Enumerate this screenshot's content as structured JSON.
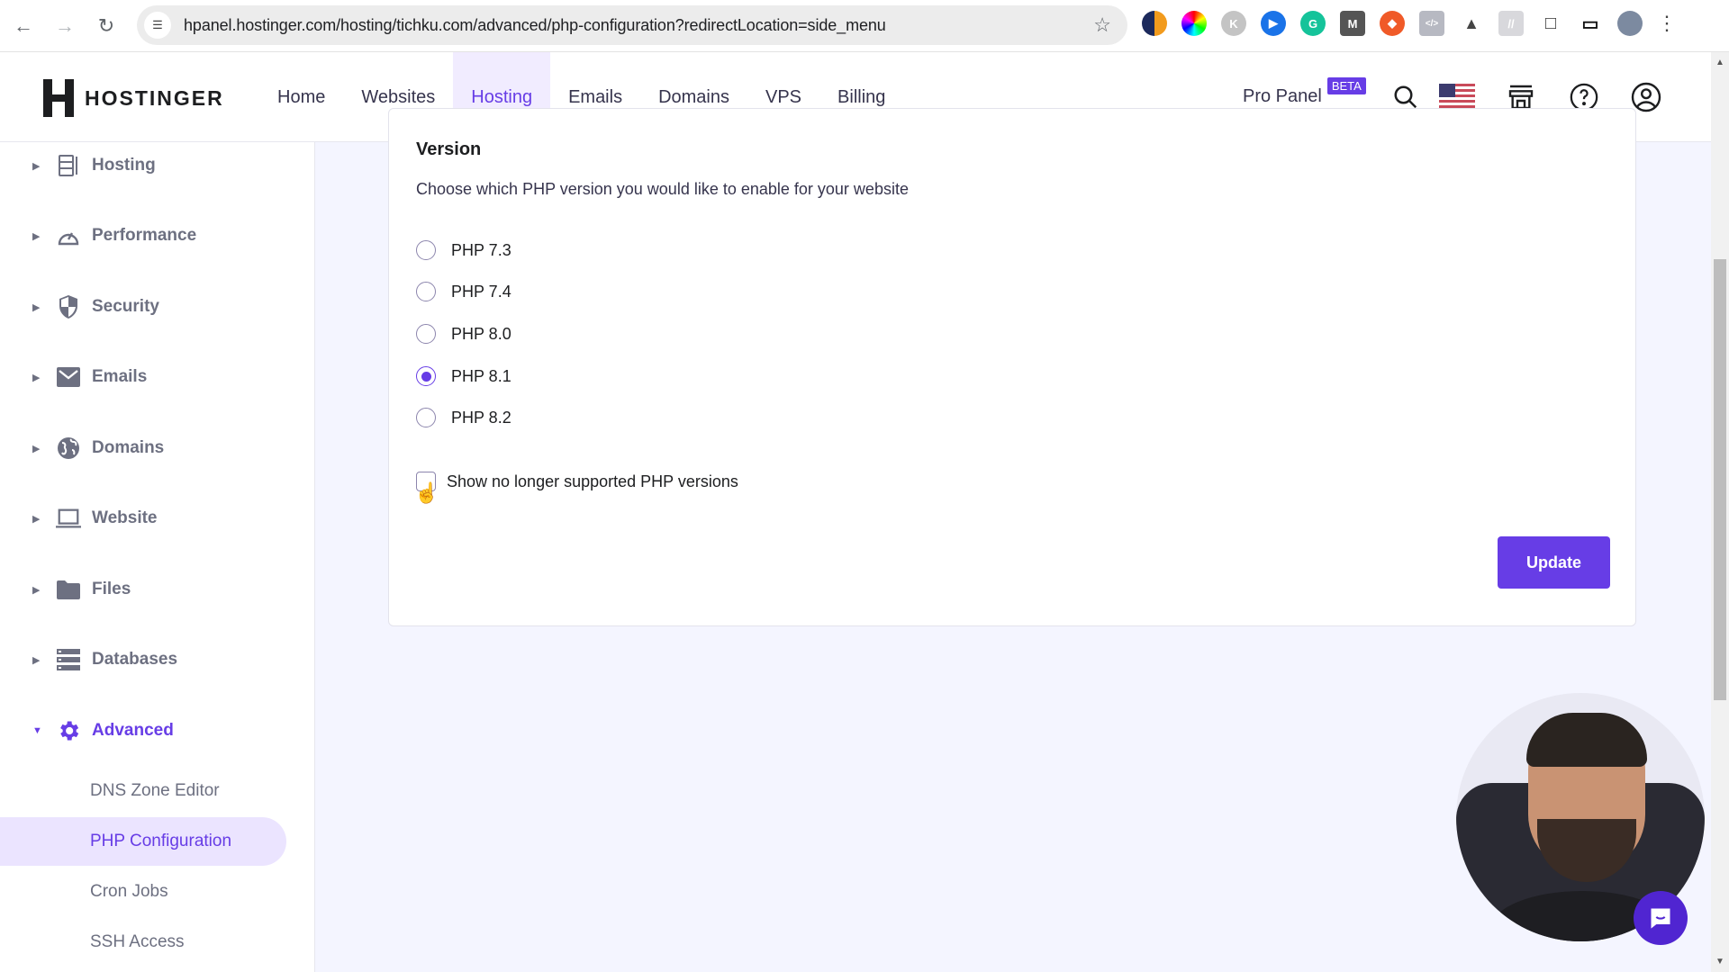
{
  "browser": {
    "url": "hpanel.hostinger.com/hosting/tichku.com/advanced/php-configuration?redirectLocation=side_menu",
    "extensions": [
      "extension-1",
      "color-picker-extension",
      "k-extension",
      "play-extension",
      "grammarly-extension",
      "m-extension",
      "fox-extension",
      "code-extension",
      "a-extension",
      "slash-extension"
    ]
  },
  "header": {
    "brand": "HOSTINGER",
    "nav": [
      {
        "label": "Home",
        "active": false
      },
      {
        "label": "Websites",
        "active": false
      },
      {
        "label": "Hosting",
        "active": true
      },
      {
        "label": "Emails",
        "active": false
      },
      {
        "label": "Domains",
        "active": false
      },
      {
        "label": "VPS",
        "active": false
      },
      {
        "label": "Billing",
        "active": false
      }
    ],
    "pro_panel": "Pro Panel",
    "beta_badge": "BETA"
  },
  "sidebar": {
    "items": [
      {
        "label": "Hosting",
        "icon": "server-icon",
        "expanded": false
      },
      {
        "label": "Performance",
        "icon": "speedometer-icon",
        "expanded": false
      },
      {
        "label": "Security",
        "icon": "shield-icon",
        "expanded": false
      },
      {
        "label": "Emails",
        "icon": "envelope-icon",
        "expanded": false
      },
      {
        "label": "Domains",
        "icon": "globe-icon",
        "expanded": false
      },
      {
        "label": "Website",
        "icon": "laptop-icon",
        "expanded": false
      },
      {
        "label": "Files",
        "icon": "folder-icon",
        "expanded": false
      },
      {
        "label": "Databases",
        "icon": "database-icon",
        "expanded": false
      },
      {
        "label": "Advanced",
        "icon": "gear-icon",
        "expanded": true
      }
    ],
    "sub_items": [
      {
        "label": "DNS Zone Editor",
        "active": false
      },
      {
        "label": "PHP Configuration",
        "active": true
      },
      {
        "label": "Cron Jobs",
        "active": false
      },
      {
        "label": "SSH Access",
        "active": false
      }
    ]
  },
  "main": {
    "section_title": "Version",
    "section_description": "Choose which PHP version you would like to enable for your website",
    "php_versions": [
      {
        "label": "PHP 7.3",
        "selected": false
      },
      {
        "label": "PHP 7.4",
        "selected": false
      },
      {
        "label": "PHP 8.0",
        "selected": false
      },
      {
        "label": "PHP 8.1",
        "selected": true
      },
      {
        "label": "PHP 8.2",
        "selected": false
      }
    ],
    "show_unsupported_label": "Show no longer supported PHP versions",
    "show_unsupported_checked": false,
    "update_button": "Update"
  },
  "colors": {
    "accent": "#673de6",
    "accent_light": "#ebe4ff",
    "text_muted": "#6d7081",
    "page_bg": "#f4f5ff"
  }
}
